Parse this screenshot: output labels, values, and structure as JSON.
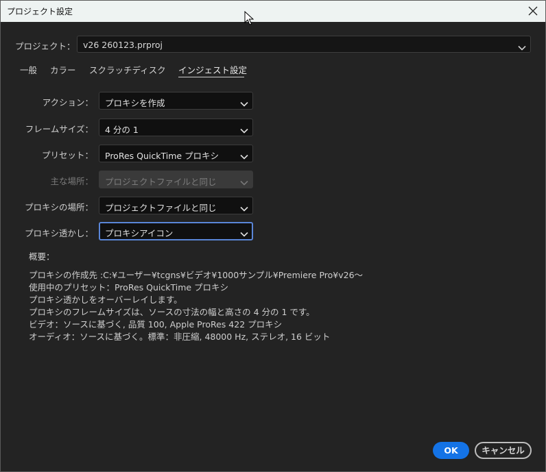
{
  "window": {
    "title": "プロジェクト設定"
  },
  "project": {
    "label": "プロジェクト：",
    "value": "v26 260123.prproj"
  },
  "tabs": [
    {
      "label": "一般"
    },
    {
      "label": "カラー"
    },
    {
      "label": "スクラッチディスク"
    },
    {
      "label": "インジェスト設定",
      "active": true
    }
  ],
  "fields": [
    {
      "label": "アクション：",
      "value": "プロキシを作成"
    },
    {
      "label": "フレームサイズ：",
      "value": "4 分の 1"
    },
    {
      "label": "プリセット：",
      "value": "ProRes QuickTime プロキシ"
    },
    {
      "label": "主な場所：",
      "value": "プロジェクトファイルと同じ",
      "disabled": true
    },
    {
      "label": "プロキシの場所：",
      "value": "プロジェクトファイルと同じ"
    },
    {
      "label": "プロキシ透かし：",
      "value": "プロキシアイコン",
      "focused": true
    }
  ],
  "summary": {
    "title": "概要：",
    "lines": [
      "プロキシの作成先 :C:¥ユーザー¥tcgns¥ビデオ¥1000サンプル¥Premiere Pro¥v26～",
      "使用中のプリセット：ProRes QuickTime プロキシ",
      "プロキシ透かしをオーバーレイします。",
      "プロキシのフレームサイズは、ソースの寸法の幅と高さの 4 分の 1 です。",
      "ビデオ：ソースに基づく, 品質 100, Apple ProRes 422 プロキシ",
      "オーディオ：ソースに基づく。標準：非圧縮, 48000 Hz, ステレオ, 16 ビット"
    ]
  },
  "buttons": {
    "ok": "OK",
    "cancel": "キャンセル"
  },
  "colors": {
    "accent": "#1473e6",
    "focus_ring": "#5a86d8",
    "background": "#232323",
    "titlebar": "#eef3f2"
  },
  "icons": {
    "close": "close-icon",
    "dropdown": "chevron-down-icon",
    "cursor": "mouse-pointer-icon"
  }
}
